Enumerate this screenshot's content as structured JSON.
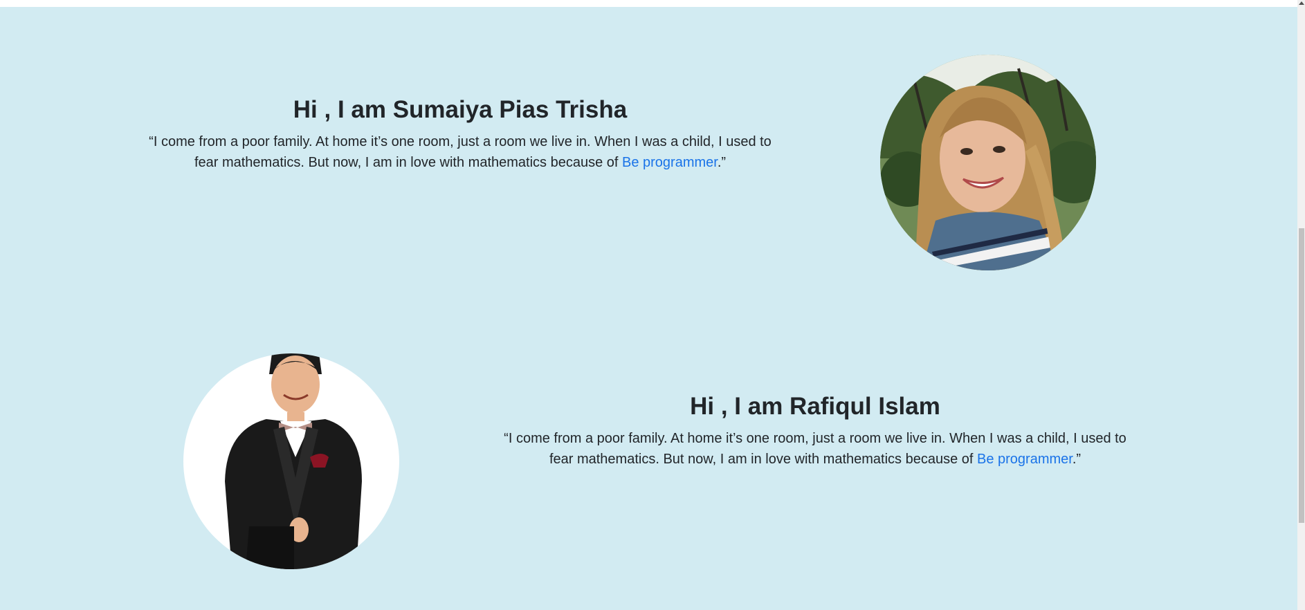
{
  "testimonials": [
    {
      "heading": "Hi , I am Sumaiya Pias Trisha",
      "quote_before": "“I come from a poor family. At home it’s one room, just a room we live in. When I was a child, I used to fear mathematics. But now, I am in love with mathematics because of ",
      "link_text": "Be programmer",
      "quote_after": ".”"
    },
    {
      "heading": "Hi , I am Rafiqul Islam",
      "quote_before": "“I come from a poor family. At home it’s one room, just a room we live in. When I was a child, I used to fear mathematics. But now, I am in love with mathematics because of ",
      "link_text": "Be programmer",
      "quote_after": ".”"
    }
  ],
  "colors": {
    "background": "#d2ebf2",
    "link": "#1a73e8",
    "text": "#212529"
  }
}
